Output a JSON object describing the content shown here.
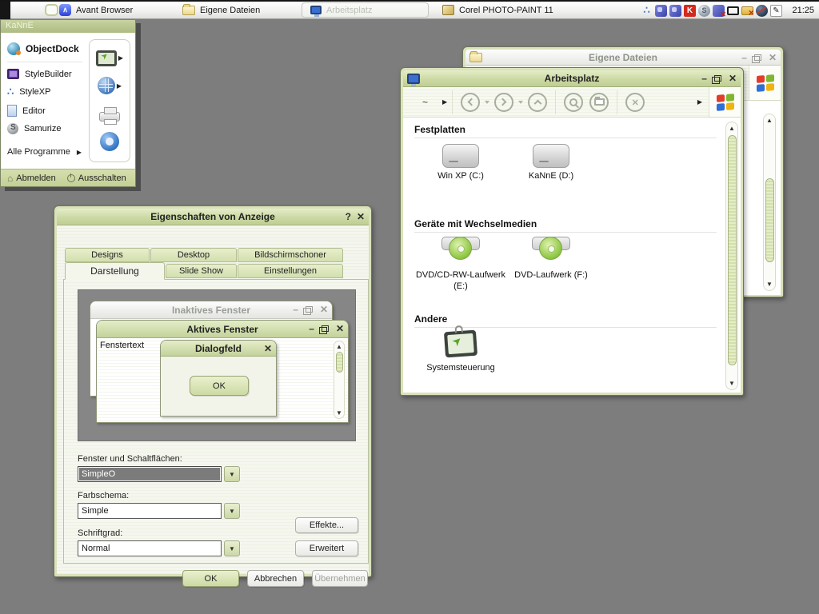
{
  "colors": {
    "accent": "#c8d6a2",
    "desktop": "#7d7d7d",
    "title_green_light": "#e4edc8",
    "title_green_dark": "#bfce93"
  },
  "glyphs": {
    "minimize": "–",
    "close": "✕",
    "help": "?",
    "dropdown": "▼",
    "arrow_right": "▶",
    "scroll_up": "▲",
    "scroll_down": "▼"
  },
  "taskbar": {
    "items": [
      {
        "label": "Avant Browser",
        "icon": "avant-browser-icon"
      },
      {
        "label": "Eigene Dateien",
        "icon": "folder-icon"
      },
      {
        "label": "Arbeitsplatz",
        "icon": "my-computer-icon",
        "active": true
      },
      {
        "label": "Corel PHOTO-PAINT 11",
        "icon": "corel-icon"
      }
    ],
    "tray_icons": [
      "dots-icon",
      "users-blue-icon",
      "users-blue-icon",
      "antivirus-k-icon",
      "sphere-icon",
      "network-error-icon",
      "monitor-icon",
      "mail-error-icon",
      "globe-blocked-icon",
      "pen-input-icon"
    ],
    "clock": "21:25"
  },
  "start_menu": {
    "title": "KaNnE",
    "items": [
      {
        "label": "ObjectDock",
        "icon": "objectdock-icon"
      },
      {
        "label": "StyleBuilder",
        "icon": "stylebuilder-icon"
      },
      {
        "label": "StyleXP",
        "icon": "stylexp-icon"
      },
      {
        "label": "Editor",
        "icon": "editor-icon"
      },
      {
        "label": "Samurize",
        "icon": "samurize-icon"
      }
    ],
    "right_icons": [
      "display-properties-icon",
      "internet-globe-icon",
      "printer-icon",
      "gear-icon"
    ],
    "all_programs": "Alle Programme",
    "logoff": "Abmelden",
    "shutdown": "Ausschalten"
  },
  "my_documents_window": {
    "title": "Eigene Dateien"
  },
  "my_computer": {
    "title": "Arbeitsplatz",
    "address": "~",
    "sections": [
      {
        "header": "Festplatten",
        "items": [
          {
            "label": "Win XP (C:)",
            "icon": "hard-drive-icon"
          },
          {
            "label": "KaNnE (D:)",
            "icon": "hard-drive-icon"
          }
        ]
      },
      {
        "header": "Geräte mit Wechselmedien",
        "items": [
          {
            "label": "DVD/CD-RW-Laufwerk (E:)",
            "icon": "dvd-drive-icon"
          },
          {
            "label": "DVD-Laufwerk (F:)",
            "icon": "dvd-drive-icon"
          }
        ]
      },
      {
        "header": "Andere",
        "items": [
          {
            "label": "Systemsteuerung",
            "icon": "control-panel-icon"
          }
        ]
      }
    ]
  },
  "display_properties": {
    "title": "Eigenschaften von Anzeige",
    "tabs_row1": [
      {
        "label": "Designs"
      },
      {
        "label": "Desktop"
      },
      {
        "label": "Bildschirmschoner"
      }
    ],
    "tabs_row2": [
      {
        "label": "Darstellung",
        "active": true
      },
      {
        "label": "Slide Show"
      },
      {
        "label": "Einstellungen"
      }
    ],
    "preview": {
      "inactive_window_title": "Inaktives Fenster",
      "active_window_title": "Aktives Fenster",
      "window_text": "Fenstertext",
      "dialog_title": "Dialogfeld",
      "ok_label": "OK"
    },
    "fields": [
      {
        "label": "Fenster und Schaltflächen:",
        "value": "SimpleO"
      },
      {
        "label": "Farbschema:",
        "value": "Simple"
      },
      {
        "label": "Schriftgrad:",
        "value": "Normal"
      }
    ],
    "effects_button": "Effekte...",
    "advanced_button": "Erweitert",
    "ok_button": "OK",
    "cancel_button": "Abbrechen",
    "apply_button": "Übernehmen"
  }
}
